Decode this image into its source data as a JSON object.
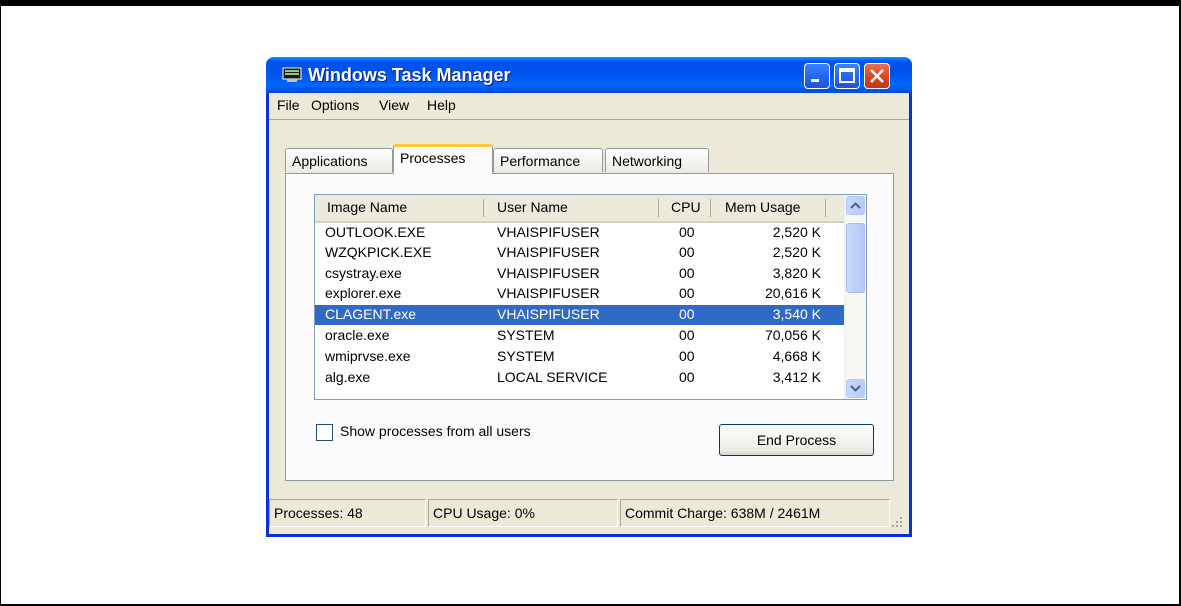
{
  "window": {
    "title": "Windows Task Manager",
    "colors": {
      "titlebar": "#0054e3",
      "selection": "#316ac5",
      "face": "#ece9d8"
    }
  },
  "menu": [
    {
      "label": "File"
    },
    {
      "label": "Options"
    },
    {
      "label": "View"
    },
    {
      "label": "Help"
    }
  ],
  "tabs": [
    {
      "label": "Applications"
    },
    {
      "label": "Processes",
      "active": true
    },
    {
      "label": "Performance"
    },
    {
      "label": "Networking"
    }
  ],
  "processes": {
    "columns": [
      "Image Name",
      "User Name",
      "CPU",
      "Mem Usage"
    ],
    "rows": [
      [
        "OUTLOOK.EXE",
        "VHAISPIFUSER",
        "00",
        "2,520 K"
      ],
      [
        "WZQKPICK.EXE",
        "VHAISPIFUSER",
        "00",
        "2,520 K"
      ],
      [
        "csystray.exe",
        "VHAISPIFUSER",
        "00",
        "3,820 K"
      ],
      [
        "explorer.exe",
        "VHAISPIFUSER",
        "00",
        "20,616 K"
      ],
      [
        "CLAGENT.exe",
        "VHAISPIFUSER",
        "00",
        "3,540 K"
      ],
      [
        "oracle.exe",
        "SYSTEM",
        "00",
        "70,056 K"
      ],
      [
        "wmiprvse.exe",
        "SYSTEM",
        "00",
        "4,668 K"
      ],
      [
        "alg.exe",
        "LOCAL SERVICE",
        "00",
        "3,412 K"
      ]
    ],
    "selected_row": 4
  },
  "show_all_users": {
    "label": "Show processes from all users",
    "checked": false
  },
  "end_process_label": "End Process",
  "status": {
    "processes": "Processes: 48",
    "cpu_usage": "CPU Usage: 0%",
    "commit_charge": "Commit Charge: 638M / 2461M"
  }
}
